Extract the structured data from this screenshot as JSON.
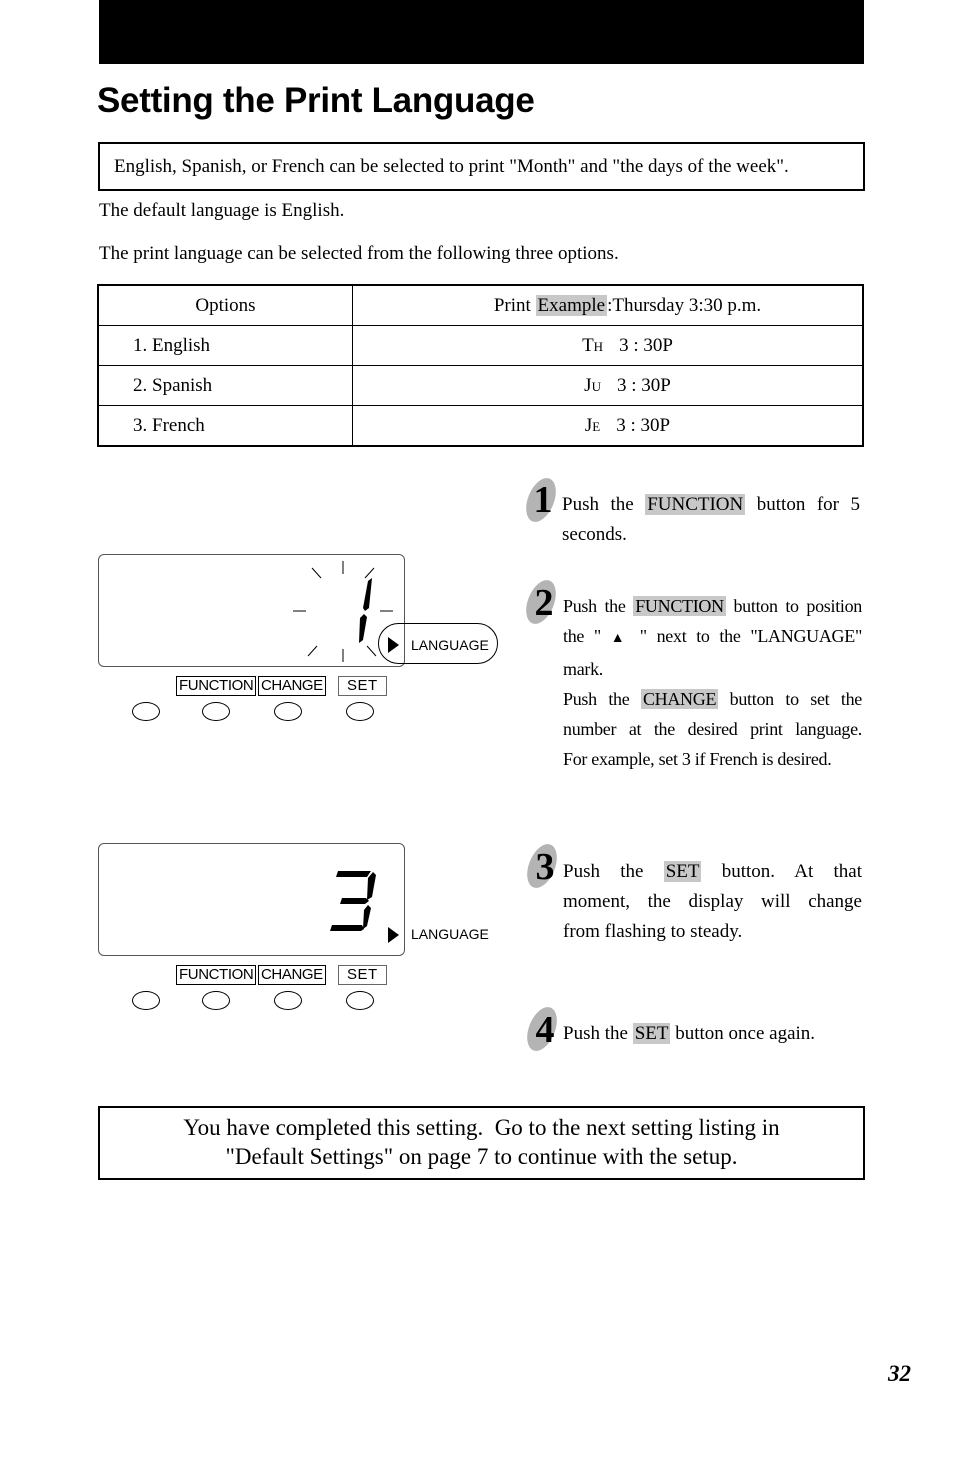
{
  "page": {
    "title": "Setting the Print Language",
    "intro": "English, Spanish, or French can be selected to print \"Month\" and \"the days of the week\".",
    "default_note": "The default language is English.",
    "options_note": "The print language can be selected from the following three options.",
    "page_number": "32"
  },
  "table": {
    "header_options": "Options",
    "header_print_prefix": "Print ",
    "header_print_highlight": "Example",
    "header_print_suffix": ":Thursday 3:30 p.m.",
    "rows": [
      {
        "option": "1. English",
        "day_first": "T",
        "day_second": "H",
        "time": "3 : 30P"
      },
      {
        "option": "2. Spanish",
        "day_first": "J",
        "day_second": "U",
        "time": "3 : 30P"
      },
      {
        "option": "3. French",
        "day_first": "J",
        "day_second": "E",
        "time": "3 : 30P"
      }
    ]
  },
  "panel1": {
    "digit": "1",
    "state": "flashing",
    "indicator_label": "LANGUAGE",
    "indicator_icon": "triangle-right-icon",
    "buttons": [
      "FUNCTION",
      "CHANGE",
      "SET"
    ]
  },
  "panel2": {
    "digit": "3",
    "state": "steady",
    "indicator_label": "LANGUAGE",
    "indicator_icon": "triangle-right-icon",
    "buttons": [
      "FUNCTION",
      "CHANGE",
      "SET"
    ]
  },
  "steps": [
    {
      "number": "1",
      "lines": [
        {
          "pre": "Push the ",
          "hl": "FUNCTION",
          "post": " button for 5"
        },
        {
          "pre": "seconds.",
          "hl": "",
          "post": ""
        }
      ]
    },
    {
      "number": "2",
      "lines": [
        {
          "pre": "Push the ",
          "hl": "FUNCTION",
          "post": " button to position"
        },
        {
          "pre": "the \" ",
          "icon": "▲",
          "post": " \" next to the \"LANGUAGE\""
        },
        {
          "pre": "mark.",
          "hl": "",
          "post": ""
        },
        {
          "pre": "Push the ",
          "hl": "CHANGE",
          "post": " button to set the"
        },
        {
          "pre": "number at the desired print language.",
          "hl": "",
          "post": ""
        },
        {
          "pre": "For example, set 3 if French is desired.",
          "hl": "",
          "post": ""
        }
      ]
    },
    {
      "number": "3",
      "lines": [
        {
          "pre": "Push the ",
          "hl": "SET",
          "post": " button. At that"
        },
        {
          "pre": "moment, the display will change",
          "hl": "",
          "post": ""
        },
        {
          "pre": "from flashing to steady.",
          "hl": "",
          "post": ""
        }
      ]
    },
    {
      "number": "4",
      "lines": [
        {
          "pre": "Push the ",
          "hl": "SET",
          "post": " button once again."
        }
      ]
    }
  ],
  "completion": {
    "line1": "You have completed this setting.  Go to the next setting listing in",
    "line2": "\"Default Settings\" on page 7 to continue with the setup."
  },
  "colors": {
    "highlight": "#c8c8c8",
    "badge": "#b4b4b4",
    "header_bar": "#000000"
  }
}
